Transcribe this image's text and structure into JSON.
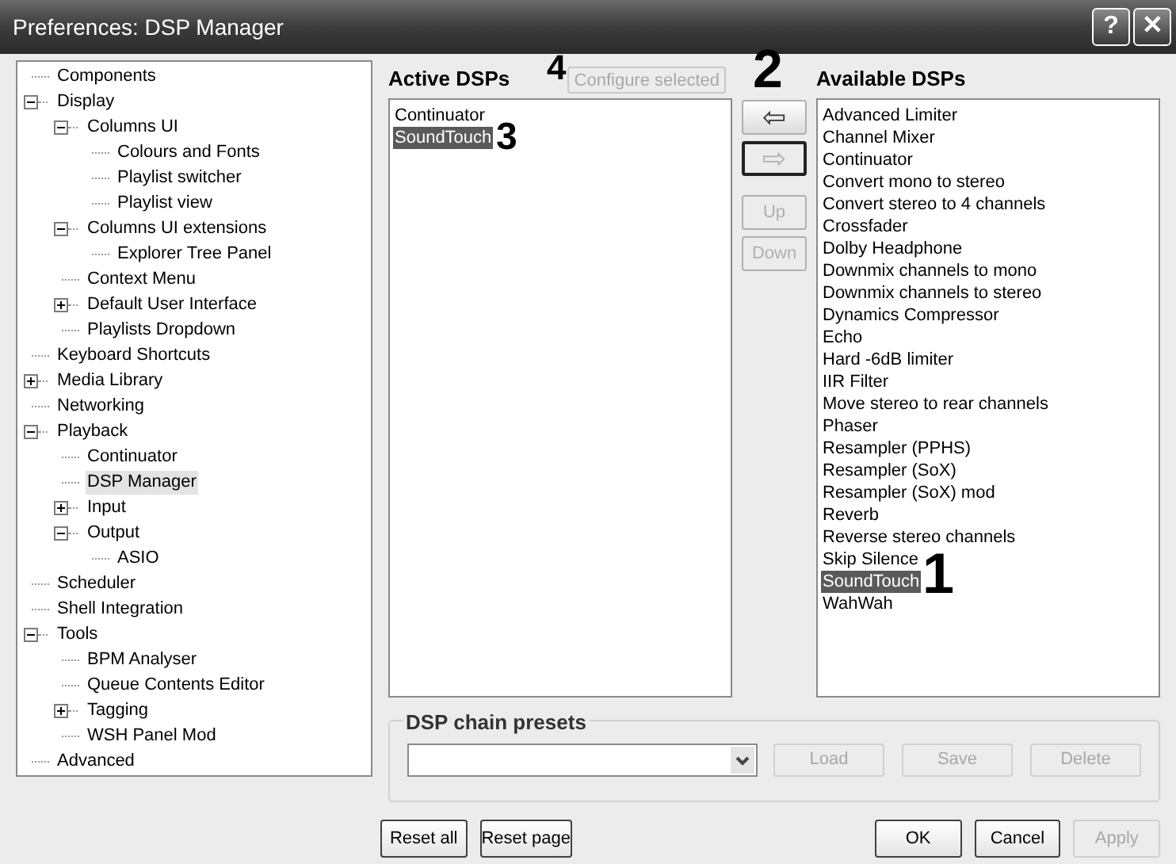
{
  "window": {
    "title": "Preferences: DSP Manager",
    "buttons": [
      "?",
      "✕"
    ]
  },
  "tree": [
    {
      "label": "Components",
      "selected": false
    },
    {
      "label": "Display",
      "selected": false,
      "expanded": true,
      "children": [
        {
          "label": "Columns UI",
          "selected": false,
          "expanded": true,
          "children": [
            {
              "label": "Colours and Fonts",
              "selected": false
            },
            {
              "label": "Playlist switcher",
              "selected": false
            },
            {
              "label": "Playlist view",
              "selected": false
            }
          ]
        },
        {
          "label": "Columns UI extensions",
          "selected": false,
          "expanded": true,
          "children": [
            {
              "label": "Explorer Tree Panel",
              "selected": false
            }
          ]
        },
        {
          "label": "Context Menu",
          "selected": false
        },
        {
          "label": "Default User Interface",
          "selected": false,
          "expanded": false
        },
        {
          "label": "Playlists Dropdown",
          "selected": false
        }
      ]
    },
    {
      "label": "Keyboard Shortcuts",
      "selected": false
    },
    {
      "label": "Media Library",
      "selected": false,
      "expanded": false
    },
    {
      "label": "Networking",
      "selected": false
    },
    {
      "label": "Playback",
      "selected": false,
      "expanded": true,
      "children": [
        {
          "label": "Continuator",
          "selected": false
        },
        {
          "label": "DSP Manager",
          "selected": true
        },
        {
          "label": "Input",
          "selected": false,
          "expanded": false
        },
        {
          "label": "Output",
          "selected": false,
          "expanded": true,
          "children": [
            {
              "label": "ASIO",
              "selected": false
            }
          ]
        }
      ]
    },
    {
      "label": "Scheduler",
      "selected": false
    },
    {
      "label": "Shell Integration",
      "selected": false
    },
    {
      "label": "Tools",
      "selected": false,
      "expanded": true,
      "children": [
        {
          "label": "BPM Analyser",
          "selected": false
        },
        {
          "label": "Queue Contents Editor",
          "selected": false
        },
        {
          "label": "Tagging",
          "selected": false,
          "expanded": false
        },
        {
          "label": "WSH Panel Mod",
          "selected": false
        }
      ]
    },
    {
      "label": "Advanced",
      "selected": false
    }
  ],
  "active_dsps": {
    "title": "Active DSPs",
    "configure_button": {
      "label": "Configure selected",
      "disabled": true
    },
    "items": [
      {
        "label": "Continuator",
        "selected": false
      },
      {
        "label": "SoundTouch",
        "selected": true
      }
    ]
  },
  "move_buttons": [
    {
      "kind": "add",
      "label": "⇦",
      "disabled": false,
      "focused": false
    },
    {
      "kind": "remove",
      "label": "⇨",
      "disabled": true,
      "focused": true
    },
    {
      "kind": "text",
      "label": "Up",
      "disabled": true,
      "focused": false
    },
    {
      "kind": "text",
      "label": "Down",
      "disabled": true,
      "focused": false
    }
  ],
  "available_dsps": {
    "title": "Available DSPs",
    "items": [
      {
        "label": "Advanced Limiter",
        "selected": false
      },
      {
        "label": "Channel Mixer",
        "selected": false
      },
      {
        "label": "Continuator",
        "selected": false
      },
      {
        "label": "Convert mono to stereo",
        "selected": false
      },
      {
        "label": "Convert stereo to 4 channels",
        "selected": false
      },
      {
        "label": "Crossfader",
        "selected": false
      },
      {
        "label": "Dolby Headphone",
        "selected": false
      },
      {
        "label": "Downmix channels to mono",
        "selected": false
      },
      {
        "label": "Downmix channels to stereo",
        "selected": false
      },
      {
        "label": "Dynamics Compressor",
        "selected": false
      },
      {
        "label": "Echo",
        "selected": false
      },
      {
        "label": "Hard -6dB limiter",
        "selected": false
      },
      {
        "label": "IIR Filter",
        "selected": false
      },
      {
        "label": "Move stereo to rear channels",
        "selected": false
      },
      {
        "label": "Phaser",
        "selected": false
      },
      {
        "label": "Resampler (PPHS)",
        "selected": false
      },
      {
        "label": "Resampler (SoX)",
        "selected": false
      },
      {
        "label": "Resampler (SoX) mod",
        "selected": false
      },
      {
        "label": "Reverb",
        "selected": false
      },
      {
        "label": "Reverse stereo channels",
        "selected": false
      },
      {
        "label": "Skip Silence",
        "selected": false
      },
      {
        "label": "SoundTouch",
        "selected": true
      },
      {
        "label": "WahWah",
        "selected": false
      }
    ]
  },
  "presets": {
    "title": "DSP chain presets",
    "buttons": [
      {
        "label": "Load",
        "disabled": true
      },
      {
        "label": "Save",
        "disabled": true
      },
      {
        "label": "Delete",
        "disabled": true
      }
    ]
  },
  "footer_buttons": [
    {
      "label": "Reset all",
      "disabled": false
    },
    {
      "label": "Reset page",
      "disabled": false
    },
    {
      "label": "OK",
      "disabled": false
    },
    {
      "label": "Cancel",
      "disabled": false
    },
    {
      "label": "Apply",
      "disabled": true
    }
  ],
  "annotations": [
    "1",
    "2",
    "3",
    "4"
  ]
}
